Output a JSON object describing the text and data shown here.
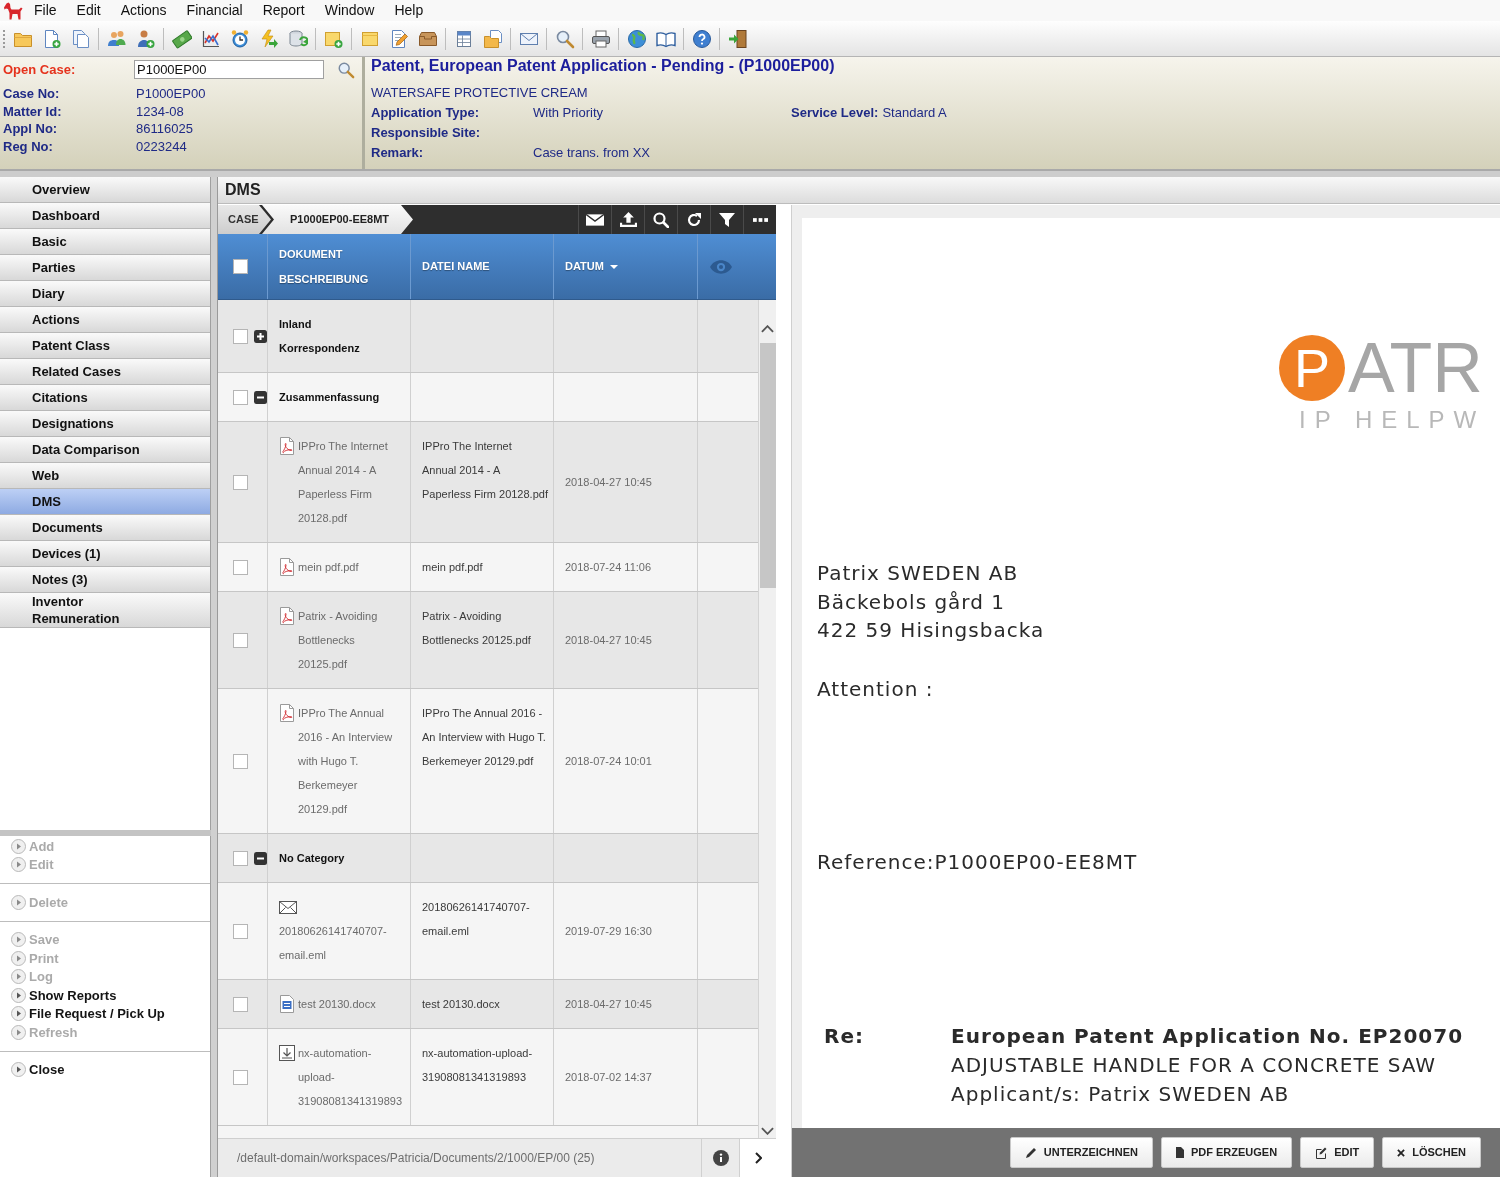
{
  "menu": [
    "File",
    "Edit",
    "Actions",
    "Financial",
    "Report",
    "Window",
    "Help"
  ],
  "case_header": {
    "open_case": {
      "label": "Open Case:",
      "value": "P1000EP00"
    },
    "fields": [
      {
        "label": "Case No:",
        "value": "P1000EP00"
      },
      {
        "label": "Matter Id:",
        "value": "1234-08"
      },
      {
        "label": "Appl No:",
        "value": "86116025"
      },
      {
        "label": "Reg No:",
        "value": "0223244"
      }
    ],
    "title": "Patent, European Patent Application - Pending - (P1000EP00)",
    "subtitle": "WATERSAFE PROTECTIVE CREAM",
    "details": [
      {
        "label": "Application Type:",
        "value": "With Priority"
      },
      {
        "label": "Responsible Site:"
      },
      {
        "label": "Remark:",
        "value": "Case trans. from XX"
      }
    ],
    "service_level": {
      "label": "Service Level:",
      "value": "Standard A"
    }
  },
  "sidebar": {
    "items": [
      {
        "label": "Overview",
        "selected": false
      },
      {
        "label": "Dashboard",
        "selected": false
      },
      {
        "label": "Basic",
        "selected": false
      },
      {
        "label": "Parties",
        "selected": false
      },
      {
        "label": "Diary",
        "selected": false
      },
      {
        "label": "Actions",
        "selected": false
      },
      {
        "label": "Patent Class",
        "selected": false
      },
      {
        "label": "Related Cases",
        "selected": false
      },
      {
        "label": "Citations",
        "selected": false
      },
      {
        "label": "Designations",
        "selected": false
      },
      {
        "label": "Data Comparison",
        "selected": false
      },
      {
        "label": "Web",
        "selected": false
      },
      {
        "label": "DMS",
        "selected": true
      },
      {
        "label": "Documents",
        "selected": false
      },
      {
        "label": "Devices (1)",
        "selected": false
      },
      {
        "label": "Notes (3)",
        "selected": false
      },
      {
        "label": "Inventor Remuneration",
        "selected": false
      }
    ]
  },
  "actions": {
    "groups": [
      {
        "items": [
          {
            "label": "Add",
            "disabled": true
          },
          {
            "label": "Edit",
            "disabled": true
          }
        ]
      },
      {
        "items": [
          {
            "label": "Delete",
            "disabled": true
          }
        ]
      },
      {
        "items": [
          {
            "label": "Save",
            "disabled": true
          },
          {
            "label": "Print",
            "disabled": true
          },
          {
            "label": "Log",
            "disabled": true
          },
          {
            "label": "Show Reports",
            "disabled": false
          },
          {
            "label": "File Request / Pick Up",
            "disabled": false
          },
          {
            "label": "Refresh",
            "disabled": true
          }
        ]
      },
      {
        "items": [
          {
            "label": "Close",
            "disabled": false
          }
        ]
      }
    ]
  },
  "dms": {
    "title": "DMS",
    "breadcrumbs": [
      "CASE",
      "P1000EP00-EE8MT"
    ],
    "table": {
      "select_all": {
        "checked": false
      },
      "columns": [
        {
          "label": "DOKUMENT BESCHREIBUNG",
          "sorted": false
        },
        {
          "label": "DATEI NAME",
          "sorted": false
        },
        {
          "label": "DATUM",
          "sorted": true
        }
      ],
      "rows": [
        {
          "kind": "category",
          "label": "Inland Korrespondenz",
          "expanded": false,
          "checked": false
        },
        {
          "kind": "category",
          "label": "Zusammenfassung",
          "expanded": true,
          "checked": false
        },
        {
          "kind": "pdf",
          "description": "IPPro The Internet Annual 2014 - A Paperless Firm 20128.pdf",
          "file_name": "IPPro The Internet Annual 2014 - A Paperless Firm 20128.pdf",
          "date": "2018-04-27 10:45",
          "checked": false
        },
        {
          "kind": "pdf",
          "description": "mein pdf.pdf",
          "file_name": "mein pdf.pdf",
          "date": "2018-07-24 11:06",
          "checked": false
        },
        {
          "kind": "pdf",
          "description": "Patrix - Avoiding Bottlenecks 20125.pdf",
          "file_name": "Patrix - Avoiding Bottlenecks 20125.pdf",
          "date": "2018-04-27 10:45",
          "checked": false
        },
        {
          "kind": "pdf",
          "description": "IPPro The Annual 2016 - An Interview with Hugo T. Berkemeyer 20129.pdf",
          "file_name": "IPPro The Annual 2016 - An Interview with Hugo T. Berkemeyer 20129.pdf",
          "date": "2018-07-24 10:01",
          "checked": false
        },
        {
          "kind": "category",
          "label": "No Category",
          "expanded": true,
          "checked": false
        },
        {
          "kind": "email",
          "description": "20180626141740707-email.eml",
          "file_name": "20180626141740707-email.eml",
          "date": "2019-07-29 16:30",
          "checked": false
        },
        {
          "kind": "docx",
          "description": "test 20130.docx",
          "file_name": "test 20130.docx",
          "date": "2018-04-27 10:45",
          "checked": false
        },
        {
          "kind": "file",
          "description": "nx-automation-upload-31908081341319893",
          "file_name": "nx-automation-upload-31908081341319893",
          "date": "2018-07-02 14:37",
          "checked": false
        }
      ]
    },
    "path": "/default-domain/workspaces/Patricia/Documents/2/1000/EP/00 (25)"
  },
  "preview": {
    "logo": {
      "mark": "P",
      "text": "ATR",
      "tagline": "IP HELPW"
    },
    "address": [
      "Patrix SWEDEN AB",
      "Bäckebols gård 1",
      "422 59 Hisingsbacka"
    ],
    "attention": "Attention :",
    "reference": "Reference:P1000EP00-EE8MT",
    "subject": {
      "label": "Re:",
      "lines": [
        "European Patent Application No. EP20070",
        "ADJUSTABLE HANDLE FOR A CONCRETE SAW",
        "Applicant/s: Patrix SWEDEN AB"
      ]
    }
  },
  "preview_actions": [
    {
      "kind": "sign",
      "label": "UNTERZEICHNEN"
    },
    {
      "kind": "pdf",
      "label": "PDF ERZEUGEN"
    },
    {
      "kind": "edit",
      "label": "EDIT"
    },
    {
      "kind": "delete",
      "label": "LÖSCHEN"
    }
  ]
}
